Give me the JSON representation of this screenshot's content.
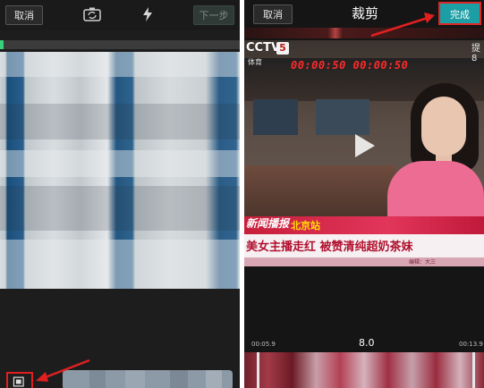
{
  "left_panel": {
    "cancel_label": "取消",
    "next_label": "下一步",
    "icons": [
      "camera-switch-icon",
      "flash-icon",
      "clip-select-icon"
    ],
    "accent_green": "#37d17a"
  },
  "right_panel": {
    "cancel_label": "取消",
    "title": "裁剪",
    "done_label": "完成",
    "accent_teal": "#1b9ea4",
    "video": {
      "channel_logo": "CCTV",
      "channel_number": "5",
      "channel_sub": "体育",
      "timecode": "00:00:50 00:00:50",
      "corner_text": "提\n8",
      "ticker_tag": "新闻播报",
      "ticker_city": "北京站",
      "ticker_headline": "美女主播走红 被赞清纯超奶茶妹",
      "ticker_small": "编辑：大三",
      "play_icon": "play-icon"
    },
    "timeline": {
      "start_time": "00:05.9",
      "duration": "8.0",
      "end_time": "00:13.9"
    }
  },
  "annotation_color": "#e02020"
}
